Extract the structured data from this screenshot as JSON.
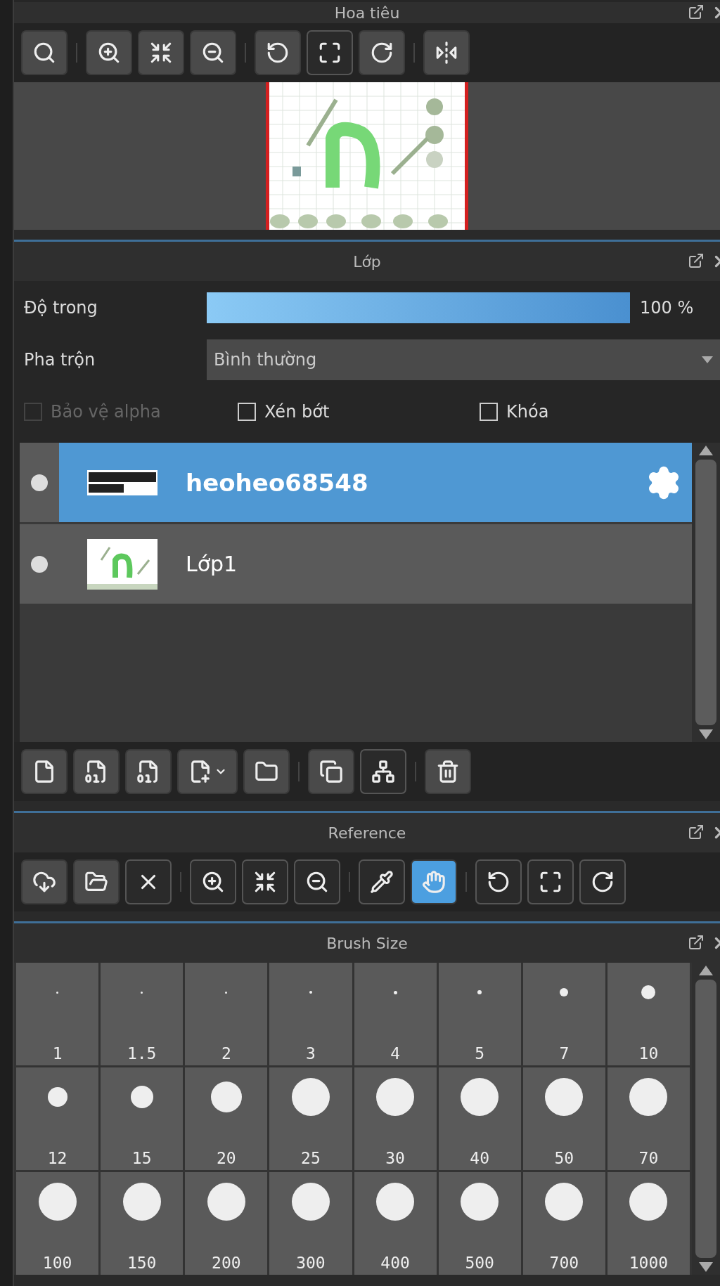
{
  "navigator": {
    "title": "Hoa tiêu",
    "toolbar": [
      [
        {
          "selected": false
        }
      ],
      [
        {
          "selected": false
        },
        {
          "selected": false
        },
        {
          "selected": false
        }
      ],
      [
        {
          "selected": false
        },
        {
          "selected": true
        },
        {
          "selected": false
        }
      ],
      [
        {
          "selected": false
        }
      ]
    ]
  },
  "layers": {
    "title": "Lớp",
    "opacity": {
      "label": "Độ trong",
      "level": 1,
      "reading": "100 %"
    },
    "blend": {
      "label": "Pha trộn",
      "value": "Bình thường"
    },
    "options": [
      {
        "label": "Bảo vệ alpha",
        "checked": false,
        "disabled": true
      },
      {
        "label": "Xén bớt",
        "checked": false,
        "disabled": false
      },
      {
        "label": "Khóa",
        "checked": false,
        "disabled": false
      }
    ],
    "items": [
      {
        "name": "heoheo68548",
        "selected": true
      },
      {
        "name": "Lớp1",
        "selected": false
      }
    ],
    "toolbar": [
      [
        {
          "selected": false
        },
        {
          "selected": false
        },
        {
          "selected": false
        },
        {
          "selected": false
        },
        {
          "selected": false
        }
      ],
      [
        {
          "selected": false
        },
        {
          "selected": true
        }
      ],
      [
        {
          "selected": false
        }
      ]
    ]
  },
  "reference": {
    "title": "Reference",
    "toolbar": [
      [
        {
          "selected": false
        },
        {
          "selected": false
        },
        {
          "selected": true
        }
      ],
      [
        {
          "selected": true
        },
        {
          "selected": true
        },
        {
          "selected": true
        }
      ],
      [
        {
          "selected": true
        },
        {
          "selected": true
        }
      ],
      [
        {
          "selected": true
        },
        {
          "selected": true
        },
        {
          "selected": true
        }
      ]
    ]
  },
  "brush_size": {
    "title": "Brush Size",
    "sizes": [
      {
        "label": "1"
      },
      {
        "label": "1.5"
      },
      {
        "label": "2"
      },
      {
        "label": "3"
      },
      {
        "label": "4"
      },
      {
        "label": "5"
      },
      {
        "label": "7"
      },
      {
        "label": "10"
      },
      {
        "label": "12"
      },
      {
        "label": "15"
      },
      {
        "label": "20"
      },
      {
        "label": "25"
      },
      {
        "label": "30"
      },
      {
        "label": "40"
      },
      {
        "label": "50"
      },
      {
        "label": "70"
      },
      {
        "label": "100"
      },
      {
        "label": "150"
      },
      {
        "label": "200"
      },
      {
        "label": "300"
      },
      {
        "label": "400"
      },
      {
        "label": "500"
      },
      {
        "label": "700"
      },
      {
        "label": "1000"
      }
    ]
  }
}
